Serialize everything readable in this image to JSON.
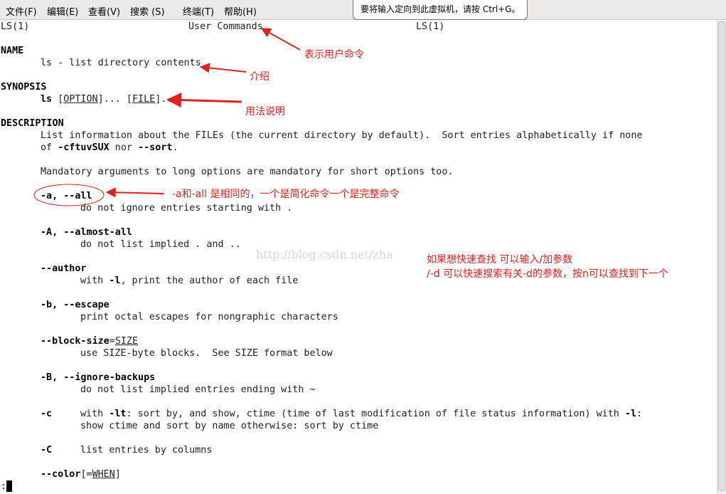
{
  "menu": {
    "file": "文件(F)",
    "edit": "编辑(E)",
    "view": "查看(V)",
    "search": "搜索 (S)",
    "terminal": "终端(T)",
    "help": "帮助(H)"
  },
  "tooltip": "要将输入定向到此虚拟机，请按 Ctrl+G。",
  "man": {
    "header_left": "LS(1)",
    "header_center": "User Commands",
    "header_right": "LS(1)",
    "name_heading": "NAME",
    "name_line": "ls - list directory contents",
    "synopsis_heading": "SYNOPSIS",
    "synopsis_cmd": "ls",
    "synopsis_option": "OPTION",
    "synopsis_file": "FILE",
    "description_heading": "DESCRIPTION",
    "desc1": "List information about the FILEs (the current directory by default).  Sort entries alphabetically if none",
    "desc2_of": "of ",
    "desc2_flags": "-cftuvSUX",
    "desc2_nor": " nor ",
    "desc2_sort": "--sort",
    "desc2_end": ".",
    "mandatory": "Mandatory arguments to long options are mandatory for short options too.",
    "opt_a": "-a, --all",
    "opt_a_desc": "do not ignore entries starting with .",
    "opt_A": "-A, --almost-all",
    "opt_A_desc": "do not list implied . and ..",
    "opt_author": "--author",
    "opt_author_desc_pre": "with ",
    "opt_author_desc_flag": "-l",
    "opt_author_desc_post": ", print the author of each file",
    "opt_b": "-b, --escape",
    "opt_b_desc": "print octal escapes for nongraphic characters",
    "opt_blocksize": "--block-size",
    "opt_blocksize_arg": "SIZE",
    "opt_blocksize_desc": "use SIZE-byte blocks.  See SIZE format below",
    "opt_B": "-B, --ignore-backups",
    "opt_B_desc": "do not list implied entries ending with ~",
    "opt_c": "-c",
    "opt_c_desc1_pre": "with ",
    "opt_c_desc1_flag": "-lt",
    "opt_c_desc1_mid": ": sort by, and show, ctime (time of last modification of file status information) with ",
    "opt_c_desc1_flag2": "-l",
    "opt_c_desc1_end": ":",
    "opt_c_desc2": "show ctime and sort by name otherwise: sort by ctime",
    "opt_C": "-C",
    "opt_C_desc": "list entries by columns",
    "opt_color": "--color",
    "opt_color_arg": "WHEN",
    "prompt": ":"
  },
  "annotations": {
    "user_cmd": "表示用户命令",
    "intro": "介绍",
    "usage": "用法说明",
    "all_same": "-a和-all  是相同的，一个是简化命令一个是完整命令",
    "search_tip1": "如果想快速查找 可以输入/加参数",
    "search_tip2": "/-d   可以快速搜索有关-d的参数，按n可以查找到下一个"
  },
  "watermark": "http://blog.csdn.net/zha",
  "colors": {
    "annotation": "#e02020",
    "menubar": "#eceae6"
  }
}
